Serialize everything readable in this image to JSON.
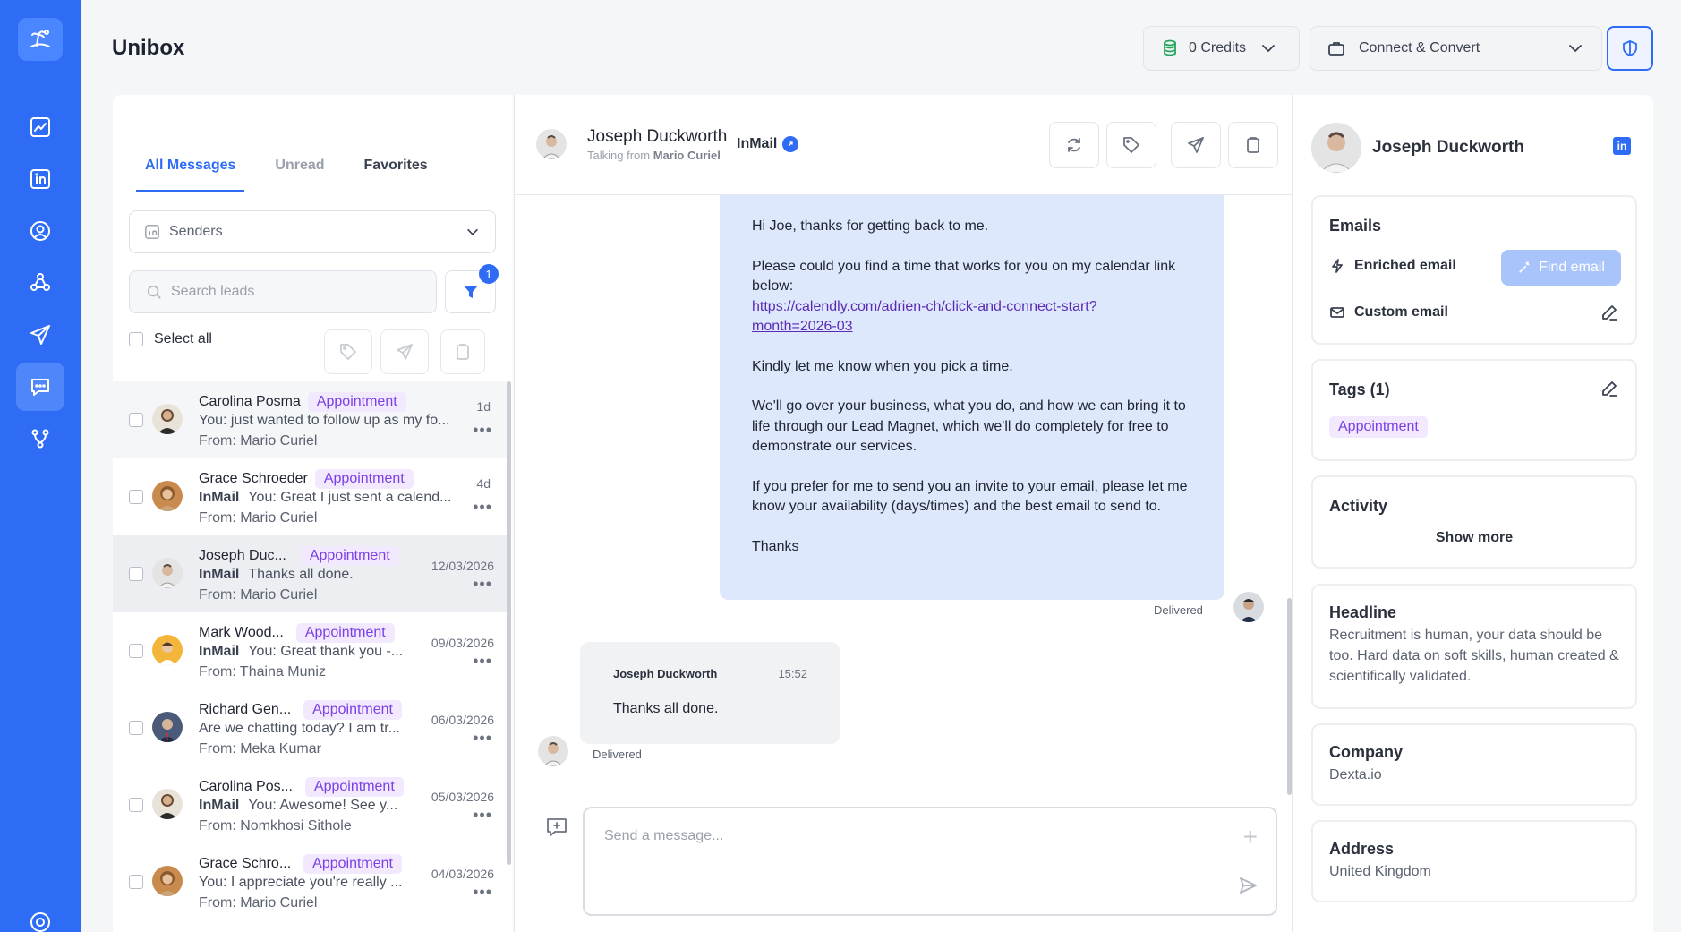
{
  "app": {
    "title": "Unibox"
  },
  "sidebar": {
    "items": [
      {
        "icon": "analytics-icon"
      },
      {
        "icon": "linkedin-icon"
      },
      {
        "icon": "profile-icon"
      },
      {
        "icon": "network-icon"
      },
      {
        "icon": "campaign-send-icon"
      },
      {
        "icon": "chat-icon",
        "active": true
      },
      {
        "icon": "workflow-icon"
      },
      {
        "icon": "settings-icon"
      }
    ]
  },
  "header": {
    "credits_label": "0 Credits",
    "connect_label": "Connect & Convert"
  },
  "inbox": {
    "tabs": [
      "All Messages",
      "Unread",
      "Favorites"
    ],
    "senders_label": "Senders",
    "search_placeholder": "Search leads",
    "filter_count": "1",
    "select_all_label": "Select all",
    "conversations": [
      {
        "name": "Carolina Posma",
        "tag": "Appointment",
        "channel": "",
        "preview": "You: just wanted to follow up as my fo...",
        "from": "From: Mario Curiel",
        "date": "1d"
      },
      {
        "name": "Grace Schroeder",
        "tag": "Appointment",
        "channel": "InMail",
        "preview": "You: Great I just sent a calend...",
        "from": "From: Mario Curiel",
        "date": "4d"
      },
      {
        "name": "Joseph Duc...",
        "tag": "Appointment",
        "channel": "InMail",
        "preview": "Thanks all done.",
        "from": "From: Mario Curiel",
        "date": "12/03/2026"
      },
      {
        "name": "Mark Wood...",
        "tag": "Appointment",
        "channel": "InMail",
        "preview": "You: Great thank you -...",
        "from": "From: Thaina Muniz",
        "date": "09/03/2026"
      },
      {
        "name": "Richard Gen...",
        "tag": "Appointment",
        "channel": "",
        "preview": "Are we chatting today?  I am tr...",
        "from": "From: Meka Kumar",
        "date": "06/03/2026"
      },
      {
        "name": "Carolina Pos...",
        "tag": "Appointment",
        "channel": "InMail",
        "preview": "You: Awesome! See y...",
        "from": "From: Nomkhosi Sithole",
        "date": "05/03/2026"
      },
      {
        "name": "Grace Schro...",
        "tag": "Appointment",
        "channel": "",
        "preview": "You: I appreciate you're really ...",
        "from": "From: Mario Curiel",
        "date": "04/03/2026"
      }
    ]
  },
  "chat": {
    "contact_name": "Joseph Duckworth",
    "talking_from_prefix": "Talking from",
    "talking_from_name": "Mario Curiel",
    "channel": "InMail",
    "outgoing": {
      "p1": "Hi Joe, thanks for getting back to me.",
      "p2": "Please could you find a time that works for you on my calendar link below:",
      "link": "https://calendly.com/adrien-ch/click-and-connect-start?month=2026-03",
      "link_line1": "https://calendly.com/adrien-ch/click-and-connect-start?",
      "link_line2": "month=2026-03",
      "p3": "Kindly let me know when you pick a time.",
      "p4": "We'll go over your business, what you do, and how we can bring it to life through our Lead Magnet, which we'll do completely for free to demonstrate our services.",
      "p5": "If you prefer for me to send you an invite to your email, please let me know your availability (days/times) and the best email to send to.",
      "p6": "Thanks",
      "status": "Delivered"
    },
    "incoming": {
      "sender": "Joseph Duckworth",
      "time": "15:52",
      "text": "Thanks all done.",
      "status": "Delivered"
    },
    "composer_placeholder": "Send a message..."
  },
  "profile": {
    "name": "Joseph Duckworth",
    "emails_title": "Emails",
    "enriched_label": "Enriched email",
    "find_email_label": "Find email",
    "custom_label": "Custom email",
    "tags_title": "Tags (1)",
    "tag": "Appointment",
    "activity_title": "Activity",
    "show_more": "Show more",
    "headline_title": "Headline",
    "headline": "Recruitment is human, your data should be too. Hard data on soft skills, human created & scientifically validated.",
    "company_title": "Company",
    "company": "Dexta.io",
    "address_title": "Address",
    "address": "United Kingdom"
  },
  "colors": {
    "brand": "#2e6cf6",
    "tag_bg": "#f2e9ff",
    "tag_text": "#7b3fe4",
    "bubble_out": "#dde8fc"
  }
}
